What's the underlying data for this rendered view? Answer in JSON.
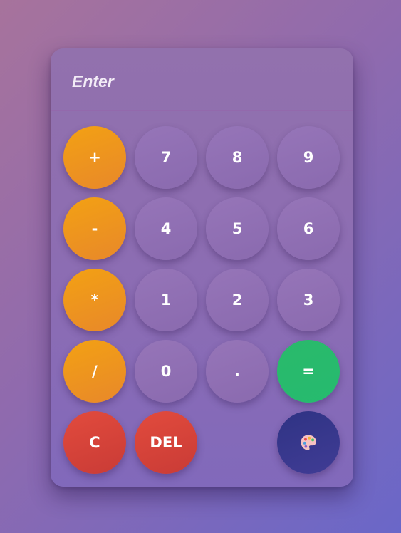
{
  "display": {
    "placeholder": "Enter",
    "value": ""
  },
  "keypad": {
    "plus": "+",
    "minus": "-",
    "multiply": "*",
    "divide": "/",
    "seven": "7",
    "eight": "8",
    "nine": "9",
    "four": "4",
    "five": "5",
    "six": "6",
    "one": "1",
    "two": "2",
    "three": "3",
    "zero": "0",
    "decimal": ".",
    "equals": "=",
    "clear": "C",
    "delete": "DEL"
  },
  "theme_button": {
    "icon": "palette-icon"
  },
  "colors": {
    "operator": "#f0961c",
    "number": "#8f6fb3",
    "equals": "#28ba6d",
    "clear": "#d8453b",
    "theme": "#35368b"
  }
}
